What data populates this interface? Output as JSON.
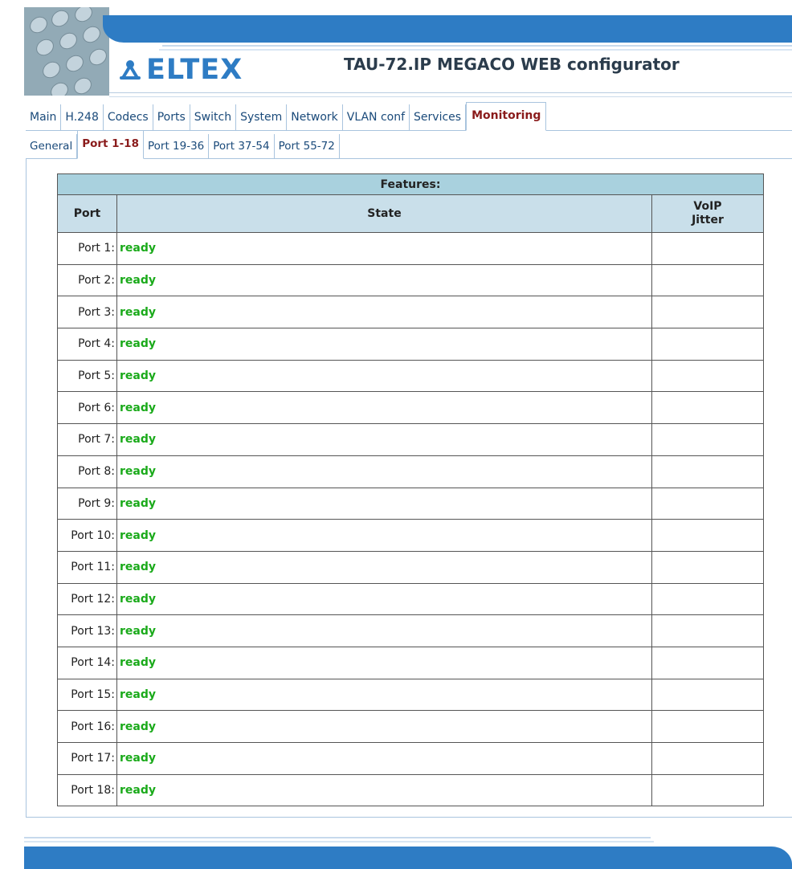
{
  "header": {
    "logo_text": "ELTEX",
    "title": "TAU-72.IP MEGACO WEB configurator"
  },
  "main_tabs": [
    {
      "label": "Main",
      "active": false
    },
    {
      "label": "H.248",
      "active": false
    },
    {
      "label": "Codecs",
      "active": false
    },
    {
      "label": "Ports",
      "active": false
    },
    {
      "label": "Switch",
      "active": false
    },
    {
      "label": "System",
      "active": false
    },
    {
      "label": "Network",
      "active": false
    },
    {
      "label": "VLAN conf",
      "active": false
    },
    {
      "label": "Services",
      "active": false
    },
    {
      "label": "Monitoring",
      "active": true
    }
  ],
  "sub_tabs": [
    {
      "label": "General",
      "active": false
    },
    {
      "label": "Port 1-18",
      "active": true
    },
    {
      "label": "Port 19-36",
      "active": false
    },
    {
      "label": "Port 37-54",
      "active": false
    },
    {
      "label": "Port 55-72",
      "active": false
    }
  ],
  "table": {
    "caption": "Features:",
    "headers": {
      "port": "Port",
      "state": "State",
      "jitter_line1": "VoIP",
      "jitter_line2": "Jitter"
    },
    "rows": [
      {
        "port": "Port 1:",
        "state": "ready",
        "jitter": ""
      },
      {
        "port": "Port 2:",
        "state": "ready",
        "jitter": ""
      },
      {
        "port": "Port 3:",
        "state": "ready",
        "jitter": ""
      },
      {
        "port": "Port 4:",
        "state": "ready",
        "jitter": ""
      },
      {
        "port": "Port 5:",
        "state": "ready",
        "jitter": ""
      },
      {
        "port": "Port 6:",
        "state": "ready",
        "jitter": ""
      },
      {
        "port": "Port 7:",
        "state": "ready",
        "jitter": ""
      },
      {
        "port": "Port 8:",
        "state": "ready",
        "jitter": ""
      },
      {
        "port": "Port 9:",
        "state": "ready",
        "jitter": ""
      },
      {
        "port": "Port 10:",
        "state": "ready",
        "jitter": ""
      },
      {
        "port": "Port 11:",
        "state": "ready",
        "jitter": ""
      },
      {
        "port": "Port 12:",
        "state": "ready",
        "jitter": ""
      },
      {
        "port": "Port 13:",
        "state": "ready",
        "jitter": ""
      },
      {
        "port": "Port 14:",
        "state": "ready",
        "jitter": ""
      },
      {
        "port": "Port 15:",
        "state": "ready",
        "jitter": ""
      },
      {
        "port": "Port 16:",
        "state": "ready",
        "jitter": ""
      },
      {
        "port": "Port 17:",
        "state": "ready",
        "jitter": ""
      },
      {
        "port": "Port 18:",
        "state": "ready",
        "jitter": ""
      }
    ]
  },
  "colors": {
    "brand_blue": "#2e7cc4",
    "active_tab_text": "#8a1b1b",
    "ready_green": "#1aaa1a",
    "caption_bg": "#a9d1de",
    "header_bg": "#c9dfea"
  },
  "icons": {
    "logo": "eltex-logo-icon",
    "banner": "keypad-photo-icon"
  }
}
